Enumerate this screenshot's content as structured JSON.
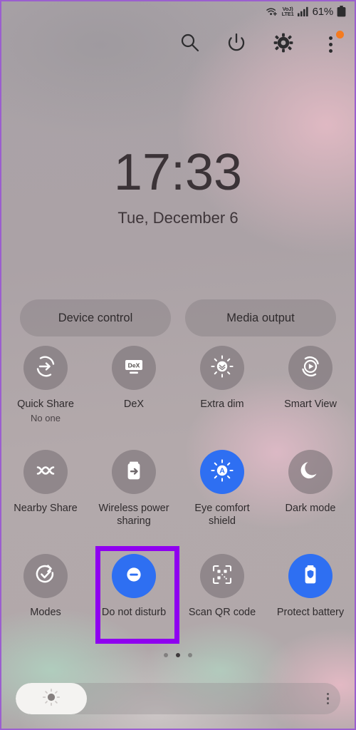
{
  "status_bar": {
    "wifi_icon": "wifi-calling-icon",
    "volte_line1": "VoJ)",
    "volte_line2": "LTE1",
    "signal_icon": "signal-bars-icon",
    "battery_percent": "61%",
    "battery_icon": "battery-icon"
  },
  "header": {
    "search_icon": "search-icon",
    "power_icon": "power-icon",
    "settings_icon": "gear-icon",
    "overflow_icon": "more-vertical-icon",
    "badge_color": "#f47b20"
  },
  "clock": {
    "time": "17:33",
    "date": "Tue, December 6"
  },
  "pills": [
    {
      "label": "Device control",
      "name": "device-control-button"
    },
    {
      "label": "Media output",
      "name": "media-output-button"
    }
  ],
  "tiles": [
    {
      "label": "Quick Share",
      "sublabel": "No one",
      "icon": "quick-share-icon",
      "active": false,
      "name": "tile-quick-share"
    },
    {
      "label": "DeX",
      "sublabel": "",
      "icon": "dex-icon",
      "active": false,
      "name": "tile-dex"
    },
    {
      "label": "Extra dim",
      "sublabel": "",
      "icon": "extra-dim-icon",
      "active": false,
      "name": "tile-extra-dim"
    },
    {
      "label": "Smart View",
      "sublabel": "",
      "icon": "smart-view-icon",
      "active": false,
      "name": "tile-smart-view"
    },
    {
      "label": "Nearby Share",
      "sublabel": "",
      "icon": "nearby-share-icon",
      "active": false,
      "name": "tile-nearby-share"
    },
    {
      "label": "Wireless power sharing",
      "sublabel": "",
      "icon": "wireless-power-sharing-icon",
      "active": false,
      "name": "tile-wireless-power-sharing"
    },
    {
      "label": "Eye comfort shield",
      "sublabel": "",
      "icon": "eye-comfort-shield-icon",
      "active": true,
      "name": "tile-eye-comfort-shield"
    },
    {
      "label": "Dark mode",
      "sublabel": "",
      "icon": "moon-icon",
      "active": false,
      "name": "tile-dark-mode"
    },
    {
      "label": "Modes",
      "sublabel": "",
      "icon": "modes-icon",
      "active": false,
      "name": "tile-modes"
    },
    {
      "label": "Do not disturb",
      "sublabel": "",
      "icon": "do-not-disturb-icon",
      "active": true,
      "name": "tile-do-not-disturb"
    },
    {
      "label": "Scan QR code",
      "sublabel": "",
      "icon": "qr-code-icon",
      "active": false,
      "name": "tile-scan-qr-code"
    },
    {
      "label": "Protect battery",
      "sublabel": "",
      "icon": "protect-battery-icon",
      "active": true,
      "name": "tile-protect-battery"
    }
  ],
  "highlight": {
    "target": "Do not disturb",
    "color": "#8f00f0"
  },
  "page_indicator": {
    "total": 3,
    "active_index": 1
  },
  "brightness": {
    "icon": "brightness-icon",
    "level_percent": 22,
    "menu_icon": "more-vertical-icon"
  },
  "theme": {
    "active_tile_color": "#2e6ff2",
    "inactive_tile_color": "#7a7377",
    "text_color": "#2f2b2d"
  }
}
